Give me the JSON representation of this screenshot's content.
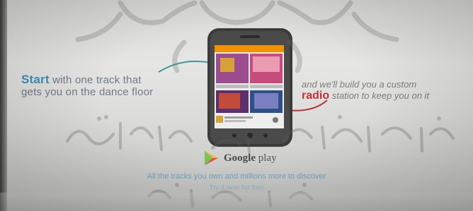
{
  "left_text": {
    "accent": "Start",
    "line1_rest": " with one track that",
    "line2": "gets you on the dance floor"
  },
  "right_text": {
    "line1": "and we'll build you a custom",
    "accent": "radio",
    "line2_rest": " station to keep you on it"
  },
  "brand": {
    "google": "Google",
    "play": " play"
  },
  "tagline": "All the tracks you own and millions more to discover",
  "cta": "Try it now for free",
  "colors": {
    "accent_blue": "#3f8fb6",
    "accent_red": "#c0303a",
    "phone_body": "#3a3a3a",
    "app_orange": "#f39200"
  },
  "icons": [
    "google-play-logo",
    "arrow-left",
    "arrow-right",
    "phone"
  ]
}
